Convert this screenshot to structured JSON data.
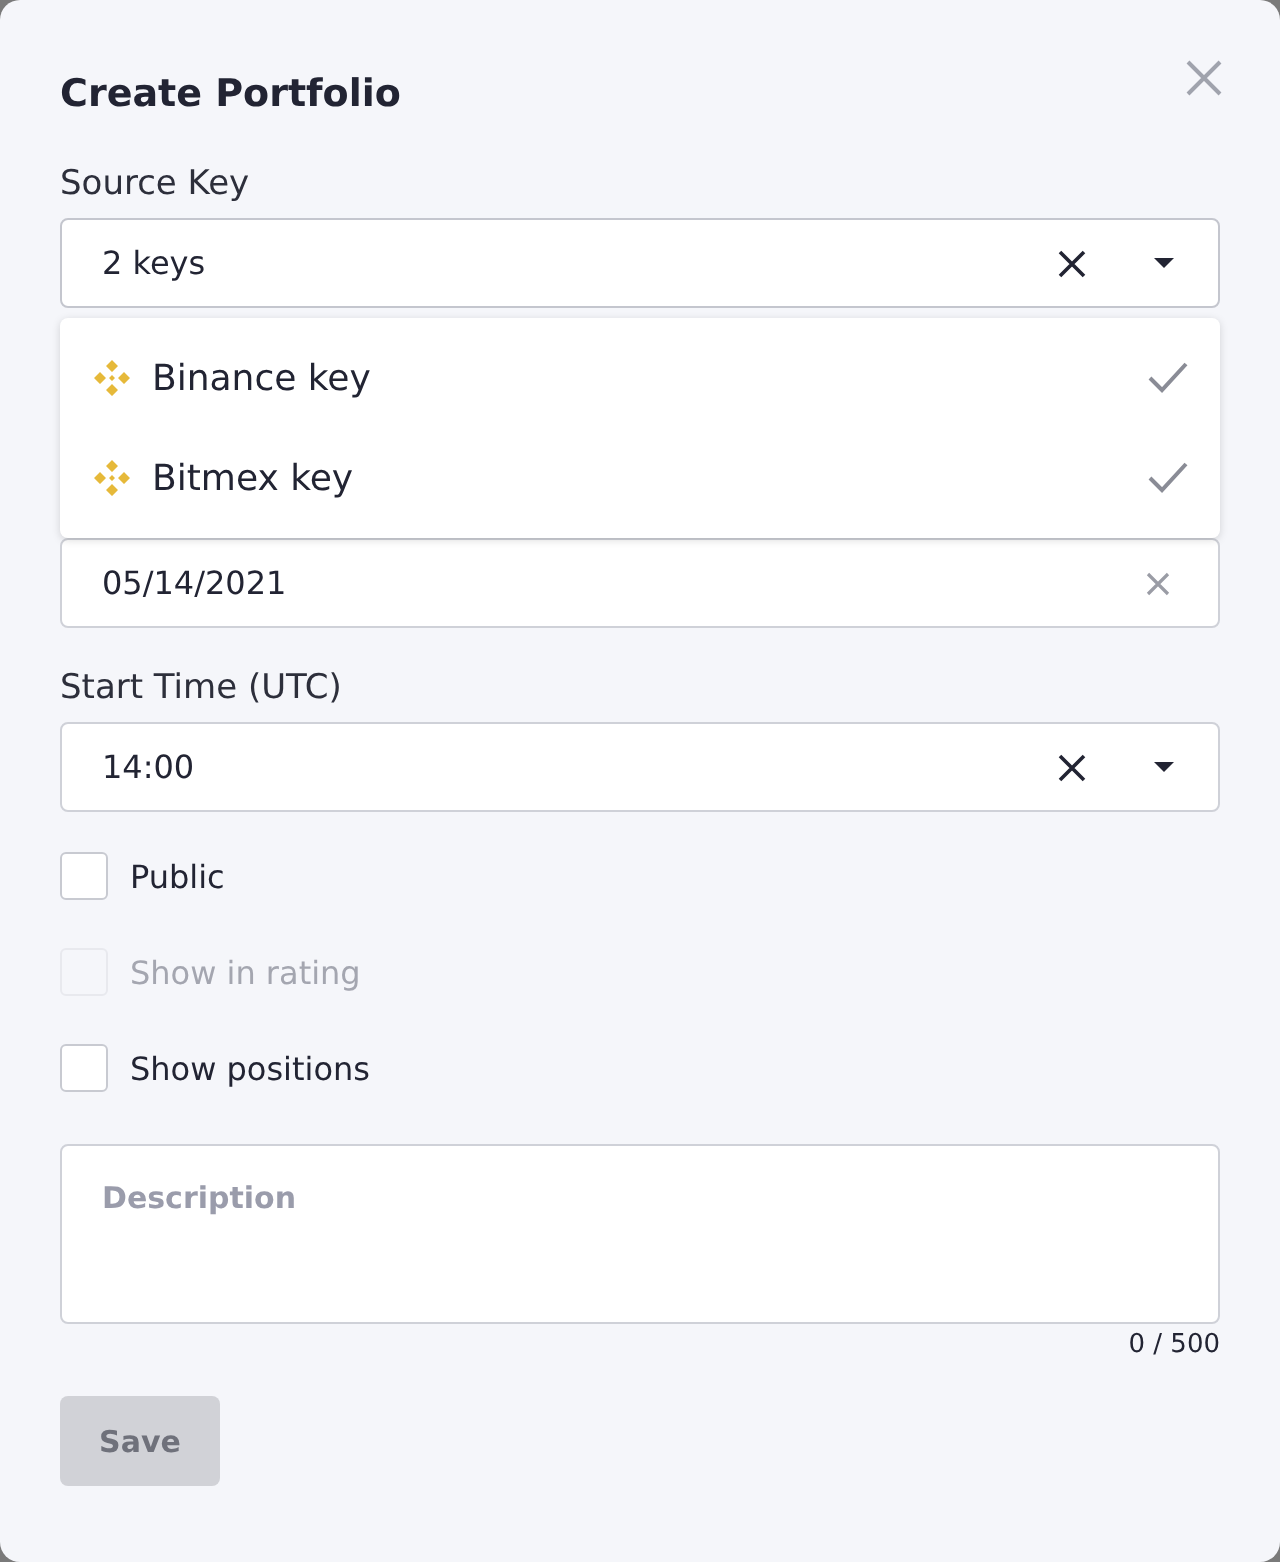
{
  "dialog": {
    "title": "Create Portfolio"
  },
  "source_key": {
    "label": "Source Key",
    "value": "2 keys",
    "expanded": true,
    "options": [
      {
        "label": "Binance key",
        "selected": true
      },
      {
        "label": "Bitmex key",
        "selected": true
      }
    ]
  },
  "start_date": {
    "value": "05/14/2021"
  },
  "start_time": {
    "label": "Start Time (UTC)",
    "value": "14:00"
  },
  "checkboxes": [
    {
      "label": "Public",
      "checked": false,
      "disabled": false
    },
    {
      "label": "Show in rating",
      "checked": false,
      "disabled": true
    },
    {
      "label": "Show positions",
      "checked": false,
      "disabled": false
    }
  ],
  "description": {
    "placeholder": "Description",
    "counter": "0 / 500"
  },
  "save_button": {
    "label": "Save",
    "disabled": true
  }
}
